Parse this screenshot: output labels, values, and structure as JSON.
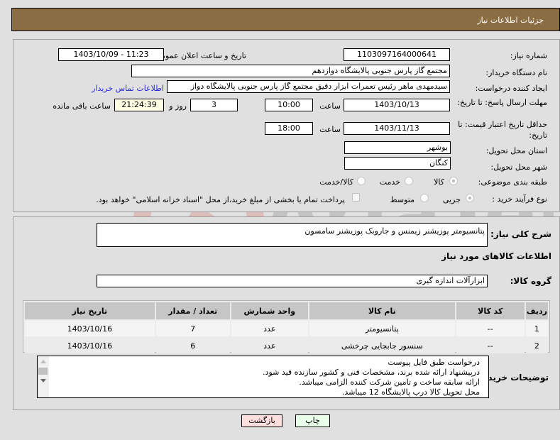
{
  "header": {
    "title": "جزئیات اطلاعات نیاز"
  },
  "form": {
    "need_number": {
      "label": "شماره نیاز:",
      "value": "1103097164000641"
    },
    "announce_datetime": {
      "label": "تاریخ و ساعت اعلان عمومی:",
      "value": "1403/10/09 - 11:23"
    },
    "buyer_org": {
      "label": "نام دستگاه خریدار:",
      "value": "مجتمع گاز پارس جنوبی  پالایشگاه دوازدهم"
    },
    "requester": {
      "label": "ایجاد کننده درخواست:",
      "value": "سیدمهدی ماهر رئیس تعمرات ابزار دقیق مجتمع گاز پارس جنوبی  پالایشگاه دواز"
    },
    "buyer_contact_link": "اطلاعات تماس خریدار",
    "response_deadline": {
      "label": "مهلت ارسال پاسخ: تا تاریخ:",
      "date": "1403/10/13",
      "time_label": "ساعت",
      "time": "10:00",
      "days": "3",
      "days_label": "روز و",
      "remaining": "21:24:39",
      "remaining_label": "ساعت باقی مانده"
    },
    "price_validity": {
      "label": "حداقل تاریخ اعتبار قیمت: تا تاریخ:",
      "date": "1403/11/13",
      "time_label": "ساعت",
      "time": "18:00"
    },
    "province": {
      "label": "استان محل تحویل:",
      "value": "بوشهر"
    },
    "city": {
      "label": "شهر محل تحویل:",
      "value": "کنگان"
    },
    "category": {
      "label": "طبقه بندی موضوعی:",
      "options": [
        "کالا",
        "خدمت",
        "کالا/خدمت"
      ],
      "selected": "کالا"
    },
    "purchase_type": {
      "label": "نوع فرآیند خرید :",
      "options": [
        "جزیی",
        "متوسط"
      ],
      "selected": "جزیی",
      "treasury_note": "پرداخت تمام یا بخشی از مبلغ خرید،از محل \"اسناد خزانه اسلامی\" خواهد بود."
    }
  },
  "description": {
    "label": "شرح کلی نیاز:",
    "value": "پتانسیومتر پوزیشنر زیمنس و جاروبک پوزیشنر سامسون"
  },
  "goods_section_title": "اطلاعات کالاهای مورد نیاز",
  "goods_group": {
    "label": "گروه کالا:",
    "value": "ابزارآلات اندازه گیری"
  },
  "table": {
    "columns": [
      "ردیف",
      "کد کالا",
      "نام کالا",
      "واحد شمارش",
      "تعداد / مقدار",
      "تاریخ نیاز"
    ],
    "rows": [
      [
        "1",
        "--",
        "پتانسیومتر",
        "عدد",
        "7",
        "1403/10/16"
      ],
      [
        "2",
        "--",
        "سنسور جابجایی چرخشی",
        "عدد",
        "6",
        "1403/10/16"
      ]
    ]
  },
  "buyer_notes": {
    "label": "توضیحات خریدار:",
    "lines": [
      "درخواست طبق فایل پیوست",
      "درپیشنهاد ارائه شده برند، مشخصات فنی و کشور سازنده قید شود.",
      "ارائه سابقه ساخت و تامین شرکت کننده الزامی میباشد.",
      "محل تحویل کالا درب پالایشگاه 12 میباشد."
    ]
  },
  "buttons": {
    "print": "چاپ",
    "back": "بازگشت"
  },
  "colors": {
    "header_bg": "#8b6d43",
    "print_bg": "#eaffea",
    "back_bg": "#ffdede",
    "link": "#2a2ad8"
  }
}
